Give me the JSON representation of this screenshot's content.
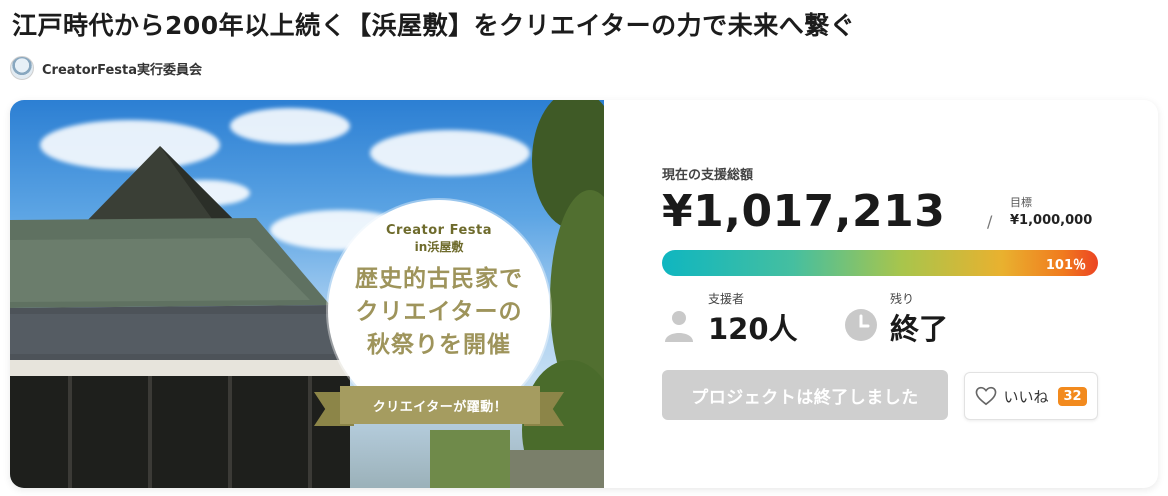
{
  "project": {
    "title": "江戸時代から200年以上続く【浜屋敷】をクリエイターの力で未来へ繋ぐ",
    "owner_name": "CreatorFesta実行委員会"
  },
  "hero": {
    "badge_en": "Creator Festa",
    "badge_location": "in浜屋敷",
    "badge_main": [
      "歴史的古民家で",
      "クリエイターの",
      "秋祭りを開催"
    ],
    "ribbon_text": "クリエイターが躍動！"
  },
  "funding": {
    "total_label": "現在の支援総額",
    "total_amount": "¥1,017,213",
    "separator": "/",
    "goal_label": "目標",
    "goal_amount": "¥1,000,000",
    "percent_label": "101％",
    "percent": 101
  },
  "stats": {
    "supporters_label": "支援者",
    "supporters_value": "120人",
    "remaining_label": "残り",
    "remaining_value": "終了"
  },
  "actions": {
    "ended_label": "プロジェクトは終了しました",
    "like_label": "いいね",
    "like_count": "32"
  },
  "colors": {
    "accent_orange": "#f28a1e",
    "ribbon_olive": "#a59c60",
    "button_disabled": "#cfcfcf"
  }
}
